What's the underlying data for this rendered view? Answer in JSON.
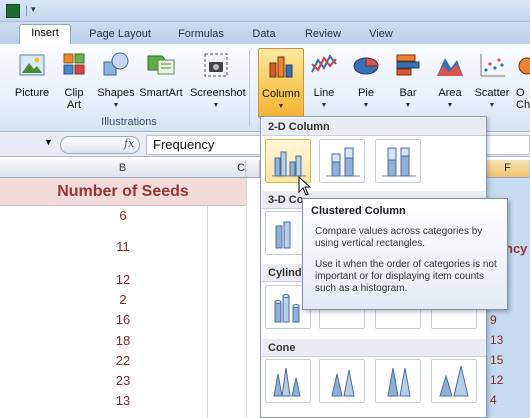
{
  "ribbon": {
    "tabs": [
      "Insert",
      "Page Layout",
      "Formulas",
      "Data",
      "Review",
      "View"
    ],
    "active_tab": "Insert",
    "buttons": [
      {
        "label": "Picture",
        "icon": "picture-icon"
      },
      {
        "label": "Clip\nArt",
        "icon": "clip-art-icon"
      },
      {
        "label": "Shapes",
        "icon": "shapes-icon"
      },
      {
        "label": "SmartArt",
        "icon": "smartart-icon"
      },
      {
        "label": "Screenshot",
        "icon": "screenshot-icon"
      },
      {
        "label": "Column",
        "icon": "column-chart-icon"
      },
      {
        "label": "Line",
        "icon": "line-chart-icon"
      },
      {
        "label": "Pie",
        "icon": "pie-chart-icon"
      },
      {
        "label": "Bar",
        "icon": "bar-chart-icon"
      },
      {
        "label": "Area",
        "icon": "area-chart-icon"
      },
      {
        "label": "Scatter",
        "icon": "scatter-chart-icon"
      },
      {
        "label": "O\nCh",
        "icon": "other-charts-icon"
      }
    ],
    "group_illustrations": "Illustrations"
  },
  "formula_bar": {
    "fx": "fx",
    "value": "Frequency"
  },
  "grid": {
    "col_headers": [
      "B",
      "C",
      "F"
    ],
    "header_cell": "Number of Seeds",
    "seed_values": [
      "6",
      "11",
      "12",
      "2",
      "16",
      "18",
      "22",
      "23",
      "13"
    ],
    "f_fragment": "ncy",
    "f_values": [
      "9",
      "13",
      "15",
      "12",
      "4"
    ]
  },
  "gallery": {
    "sections": [
      "2-D Column",
      "3-D Co",
      "Cylind",
      "Cone"
    ]
  },
  "tooltip": {
    "title": "Clustered Column",
    "line1": "Compare values across categories by using vertical rectangles.",
    "line2": "Use it when the order of categories is not important or for displaying item counts such as a histogram."
  },
  "colors": {
    "accent_pink": "#f2dbdb",
    "seed_text": "#943634",
    "selected_column": "#c6daf0",
    "active_button": "#f8c951"
  }
}
